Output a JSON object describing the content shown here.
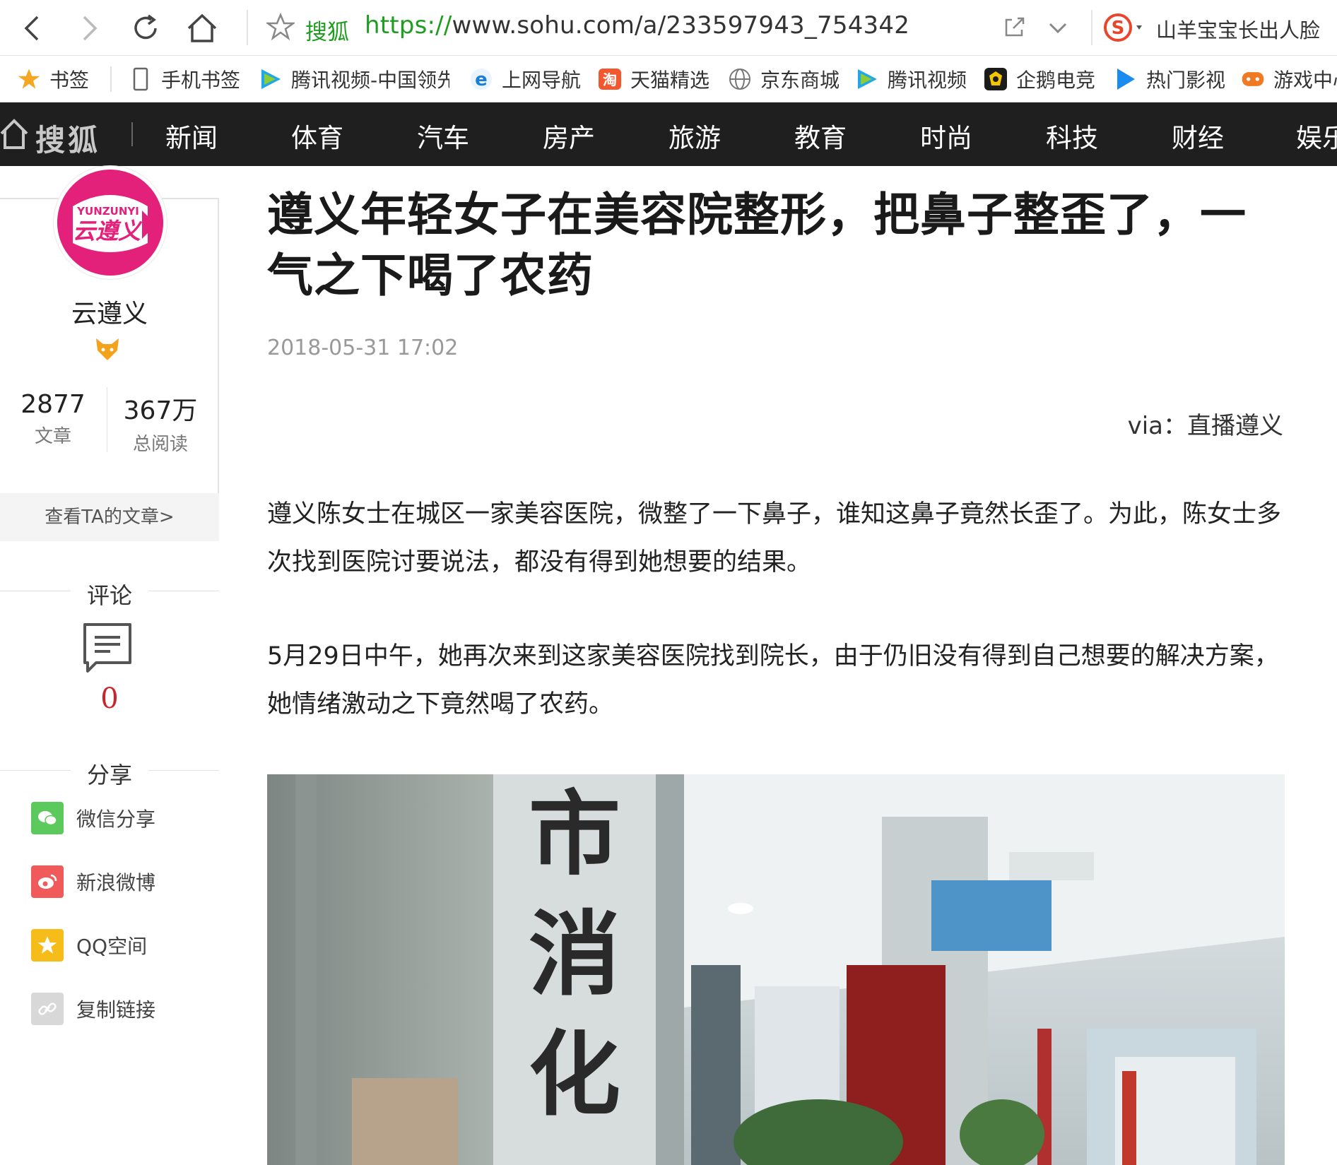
{
  "browser": {
    "site_name": "搜狐",
    "url_protocol": "https://",
    "url_rest": "www.sohu.com/a/233597943_754342",
    "search_hint": "山羊宝宝长出人脸"
  },
  "bookmarks": [
    {
      "label": "书签",
      "icon": "star-icon"
    },
    {
      "label": "手机书签",
      "icon": "phone-icon"
    },
    {
      "label": "腾讯视频-中国领先",
      "icon": "tencent-video-icon"
    },
    {
      "label": "上网导航",
      "icon": "ie-icon"
    },
    {
      "label": "天猫精选",
      "icon": "tmall-icon"
    },
    {
      "label": "京东商城",
      "icon": "globe-icon"
    },
    {
      "label": "腾讯视频",
      "icon": "tencent-video-icon"
    },
    {
      "label": "企鹅电竞",
      "icon": "penguin-esports-icon"
    },
    {
      "label": "热门影视",
      "icon": "play-icon"
    },
    {
      "label": "游戏中心",
      "icon": "gamepad-icon"
    }
  ],
  "site_nav": {
    "logo": "搜狐",
    "items": [
      "新闻",
      "体育",
      "汽车",
      "房产",
      "旅游",
      "教育",
      "时尚",
      "科技",
      "财经",
      "娱乐"
    ]
  },
  "author": {
    "name": "云遵义",
    "avatar_text_top": "YUNZUNYI",
    "avatar_text_main": "云遵义",
    "articles_count": "2877",
    "articles_label": "文章",
    "reads_count": "367万",
    "reads_label": "总阅读",
    "view_articles": "查看TA的文章>"
  },
  "comments": {
    "title": "评论",
    "count": "0"
  },
  "share": {
    "title": "分享",
    "items": [
      {
        "label": "微信分享",
        "icon": "wechat-icon",
        "color": "#5bc95b"
      },
      {
        "label": "新浪微博",
        "icon": "weibo-icon",
        "color": "#f05a5a"
      },
      {
        "label": "QQ空间",
        "icon": "qzone-star-icon",
        "color": "#f6bd1a"
      },
      {
        "label": "复制链接",
        "icon": "link-icon",
        "color": "#d8d8d8"
      }
    ]
  },
  "article": {
    "title": "遵义年轻女子在美容院整形，把鼻子整歪了，一气之下喝了农药",
    "time": "2018-05-31 17:02",
    "via": "via：直播遵义",
    "paragraphs": [
      "遵义陈女士在城区一家美容医院，微整了一下鼻子，谁知这鼻子竟然长歪了。为此，陈女士多次找到医院讨要说法，都没有得到她想要的结果。",
      "5月29日中午，她再次来到这家美容医院找到院长，由于仍旧没有得到自己想要的解决方案，她情绪激动之下竟然喝了农药。"
    ],
    "image_sign_chars": [
      "市",
      "消",
      "化"
    ]
  }
}
